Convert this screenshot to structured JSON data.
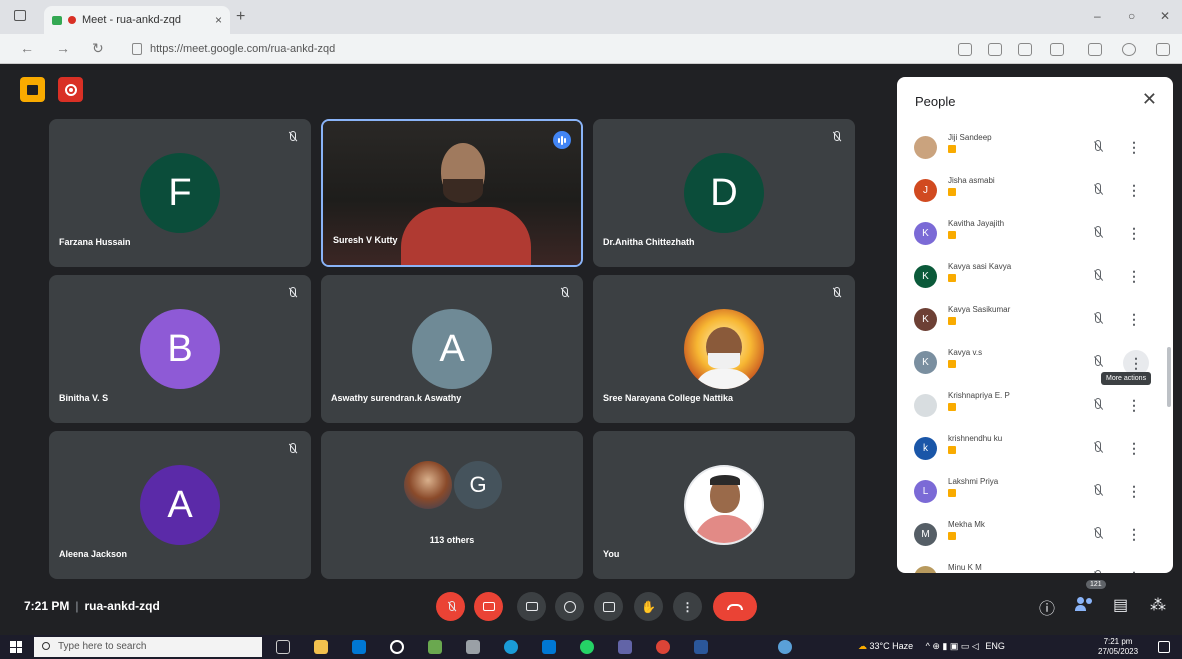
{
  "browser": {
    "tab_title": "Meet - rua-ankd-zqd",
    "tab_close": "×",
    "new_tab": "+",
    "url": "https://meet.google.com/rua-ankd-zqd",
    "window_min": "‒",
    "window_max": "○",
    "window_close": "✕"
  },
  "tiles": [
    {
      "name": "Farzana Hussain",
      "initial": "F",
      "color": "#0b4d3a"
    },
    {
      "name": "Suresh V Kutty"
    },
    {
      "name": "Dr.Anitha Chittezhath",
      "initial": "D",
      "color": "#0b4d3a"
    },
    {
      "name": "Binitha V. S",
      "initial": "B",
      "color": "#8e5ad6"
    },
    {
      "name": "Aswathy surendran.k Aswathy",
      "initial": "A",
      "color": "#6f8a96"
    },
    {
      "name": "Sree Narayana College Nattika"
    },
    {
      "name": "Aleena Jackson",
      "initial": "A",
      "color": "#5b2aa8"
    },
    {
      "name": "113 others",
      "initial": "G",
      "color": "#45535c"
    },
    {
      "name": "You"
    }
  ],
  "meeting": {
    "time": "7:21 PM",
    "separator": "|",
    "code": "rua-ankd-zqd",
    "participant_count": "121"
  },
  "people": {
    "title": "People",
    "close": "✕",
    "tooltip": "More actions",
    "list": [
      {
        "name": "Jiji Sandeep",
        "initial": "",
        "color": "#caa37e"
      },
      {
        "name": "Jisha asmabi",
        "initial": "J",
        "color": "#d14a20"
      },
      {
        "name": "Kavitha Jayajith",
        "initial": "K",
        "color": "#7b6ad6"
      },
      {
        "name": "Kavya sasi Kavya",
        "initial": "K",
        "color": "#0b5a3a"
      },
      {
        "name": "Kavya Sasikumar",
        "initial": "K",
        "color": "#6d4035"
      },
      {
        "name": "Kavya v.s",
        "initial": "K",
        "color": "#7a8fa0"
      },
      {
        "name": "Krishnapriya E. P",
        "initial": "",
        "color": "#d8dde0"
      },
      {
        "name": "krishnendhu ku",
        "initial": "k",
        "color": "#1a56a8"
      },
      {
        "name": "Lakshmi Priya",
        "initial": "L",
        "color": "#7b6ad6"
      },
      {
        "name": "Mekha Mk",
        "initial": "M",
        "color": "#555e66"
      },
      {
        "name": "Minu K M",
        "initial": "",
        "color": "#b89a5e"
      }
    ]
  },
  "taskbar": {
    "search_placeholder": "Type here to search",
    "weather": "33°C Haze",
    "lang": "ENG",
    "time": "7:21 pm",
    "date": "27/05/2023"
  }
}
